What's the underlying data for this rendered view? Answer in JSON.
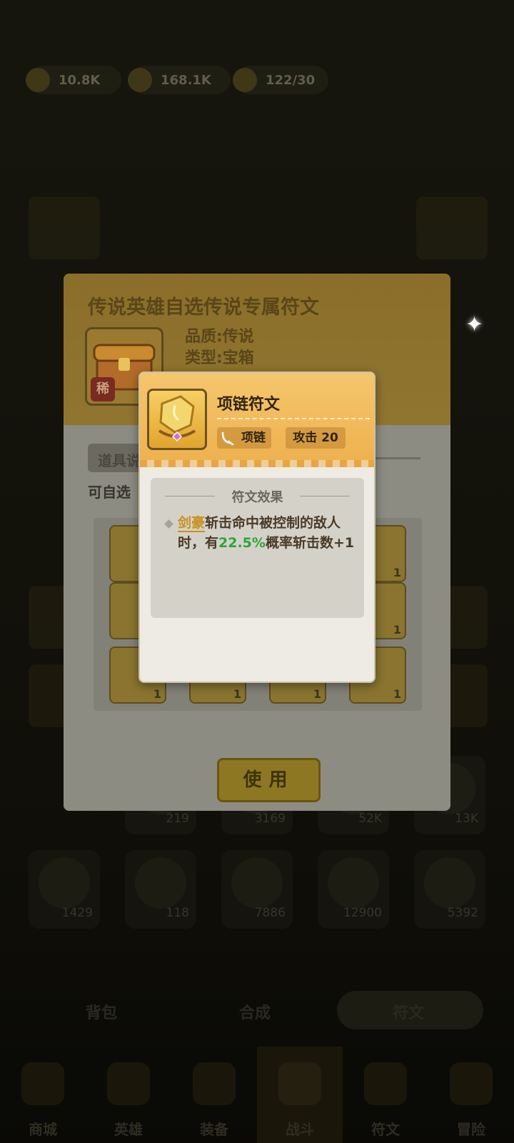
{
  "resources": [
    {
      "name": "gem",
      "value": "10.8K"
    },
    {
      "name": "gold",
      "value": "168.1K"
    },
    {
      "name": "stamina",
      "value": "122/30"
    }
  ],
  "background_counts": [
    "219",
    "3169",
    "52K",
    "13K",
    "1429",
    "118",
    "7886",
    "12900",
    "5392"
  ],
  "bottom_nav": [
    {
      "label": "商城",
      "icon": "shop-icon"
    },
    {
      "label": "英雄",
      "icon": "hero-icon"
    },
    {
      "label": "装备",
      "icon": "equipment-icon"
    },
    {
      "label": "战斗",
      "icon": "battle-icon"
    },
    {
      "label": "符文",
      "icon": "rune-icon"
    },
    {
      "label": "冒险",
      "icon": "adventure-icon"
    }
  ],
  "background_tabs": [
    "背包",
    "合成",
    "符文"
  ],
  "chest_dialog": {
    "title": "传说英雄自选传说专属符文",
    "badge": "稀",
    "quality": "品质:传说",
    "type": "类型:宝箱",
    "item_desc_tag": "道具说明",
    "item_desc": "可自选",
    "grid_qty": "1",
    "use_label": "使用"
  },
  "rune_popup": {
    "name": "项链符文",
    "slot_label": "项链",
    "stat_label": "攻击 20",
    "effect_title": "符文效果",
    "effect_hero": "剑豪",
    "effect_text_1": "斩击命中被控制的敌人时，有",
    "effect_pct": "22.5%",
    "effect_text_2": "概率斩击数+1"
  },
  "colors": {
    "accent_orange": "#eeb04d",
    "hero_gold": "#c8901c",
    "percent_green": "#2ea33a"
  }
}
